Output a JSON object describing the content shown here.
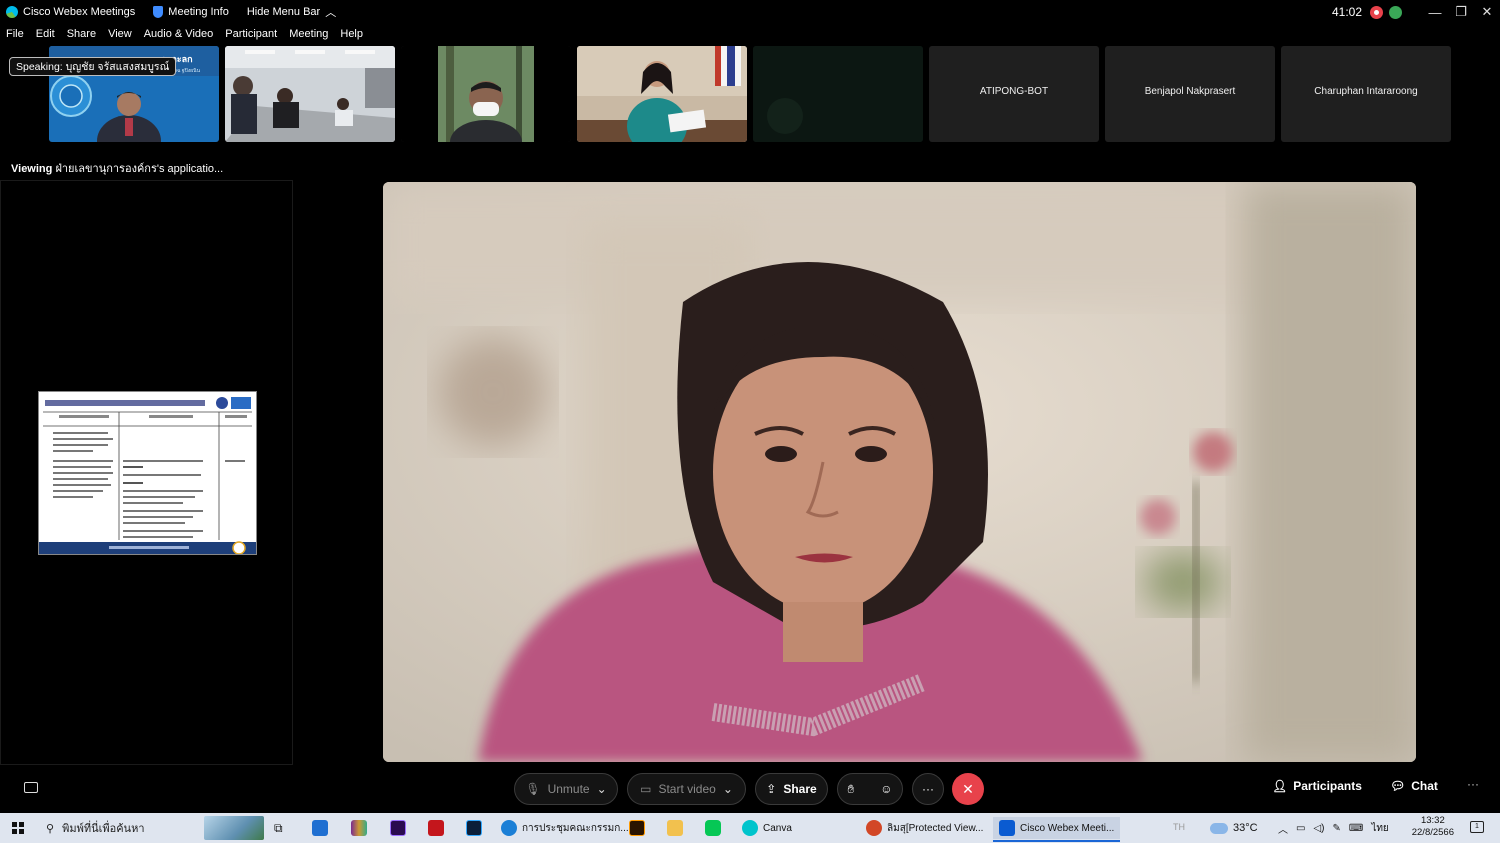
{
  "titlebar": {
    "app_name": "Cisco Webex Meetings",
    "meeting_info": "Meeting Info",
    "hide_menu": "Hide Menu Bar",
    "timer": "41:02"
  },
  "menubar": [
    "File",
    "Edit",
    "Share",
    "View",
    "Audio & Video",
    "Participant",
    "Meeting",
    "Help"
  ],
  "speaking": "Speaking: บุญชัย จรัสแสงสมบูรณ์",
  "participants": [
    {
      "name": "",
      "has_video": true
    },
    {
      "name": "",
      "has_video": true
    },
    {
      "name": "",
      "has_video": true
    },
    {
      "name": "",
      "has_video": true
    },
    {
      "name": "",
      "has_video": true
    },
    {
      "name": "ATIPONG-BOT",
      "has_video": false
    },
    {
      "name": "Benjapol Nakprasert",
      "has_video": false
    },
    {
      "name": "Charuphan Intararoong",
      "has_video": false
    }
  ],
  "viewing": {
    "prefix": "Viewing",
    "text": "ฝ่ายเลขานุการองค์กร's applicatio..."
  },
  "controls": {
    "unmute": "Unmute",
    "start_video": "Start video",
    "share": "Share",
    "participants": "Participants",
    "chat": "Chat"
  },
  "taskbar": {
    "search_placeholder": "พิมพ์ที่นี่เพื่อค้นหา",
    "apps": [
      {
        "label": "การประชุมคณะกรรมก...",
        "color": "#1b7fd6"
      },
      {
        "label": "Canva",
        "color": "#00c4cc"
      },
      {
        "label": "ลิมสุ[Protected View...",
        "color": "#d24726"
      },
      {
        "label": "Cisco Webex Meeti...",
        "color": "#0a5bd1"
      }
    ],
    "lang": "TH",
    "weather": "33°C",
    "input_lang": "ไทย",
    "time": "13:32",
    "date": "22/8/2566",
    "notif_count": "1"
  },
  "colors": {
    "end_call": "#e8424b",
    "recording": "#e8424b",
    "network": "#3aa757"
  }
}
